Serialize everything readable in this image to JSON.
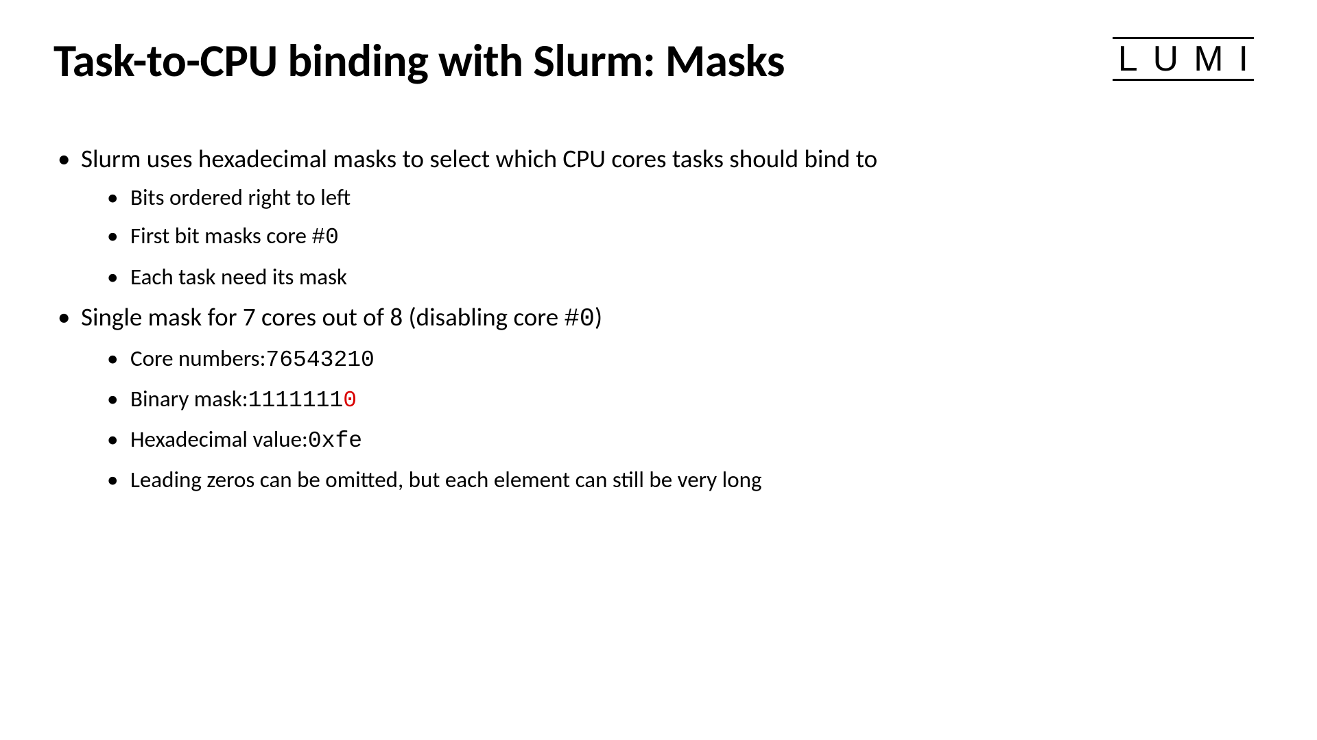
{
  "title": "Task-to-CPU binding with Slurm: Masks",
  "logo": "LUMI",
  "bullets": {
    "b1": "Slurm uses hexadecimal masks to select which CPU cores  tasks should bind to",
    "b1_sub": {
      "s1": "Bits ordered right to left",
      "s2_pre": "First bit masks core ",
      "s2_code": "#0",
      "s3": "Each task need its mask"
    },
    "b2_pre": "Single mask for 7 cores out of 8 (disabling core ",
    "b2_code": "#0",
    "b2_post": ")",
    "b2_sub": {
      "s1_label": "Core numbers:   ",
      "s1_val": "76543210",
      "s2_label": "Binary mask:      ",
      "s2_val_pre": "1111111",
      "s2_val_red": "0",
      "s3_label": "Hexadecimal value:   ",
      "s3_val": "0xfe",
      "s4": "Leading zeros can be omitted, but each element can still be very long"
    }
  }
}
